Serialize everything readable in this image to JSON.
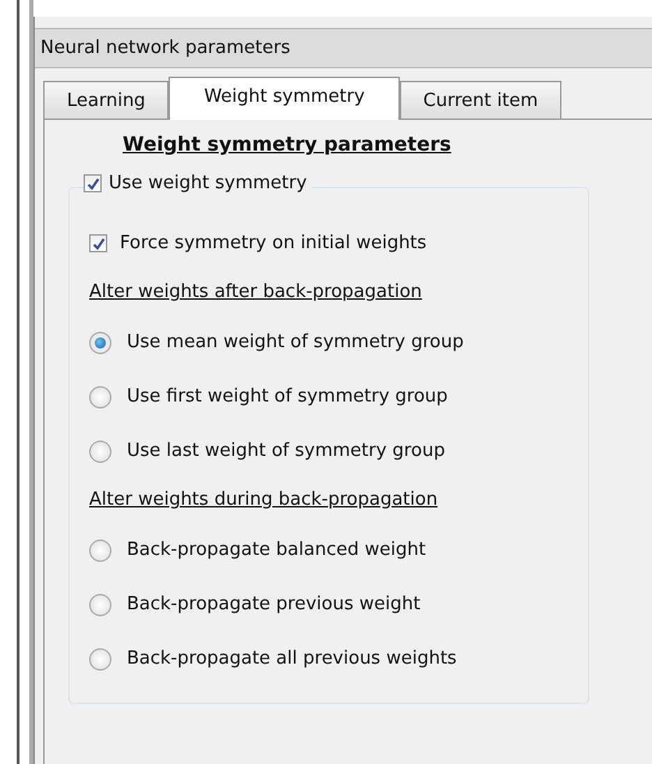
{
  "panel": {
    "title": "Neural network parameters"
  },
  "tabs": [
    {
      "label": "Learning",
      "selected": false
    },
    {
      "label": "Weight symmetry",
      "selected": true
    },
    {
      "label": "Current item",
      "selected": false
    }
  ],
  "section_title": "Weight symmetry parameters",
  "group": {
    "label": "Use weight symmetry",
    "checked": true,
    "items": [
      {
        "kind": "checkbox",
        "label": "Force symmetry on initial weights",
        "checked": true
      },
      {
        "kind": "heading",
        "label": "Alter weights after back-propagation"
      },
      {
        "kind": "radio",
        "label": "Use mean weight of symmetry group",
        "selected": true
      },
      {
        "kind": "radio",
        "label": "Use first weight of symmetry group",
        "selected": false
      },
      {
        "kind": "radio",
        "label": "Use last weight of symmetry group",
        "selected": false
      },
      {
        "kind": "heading",
        "label": "Alter weights during back-propagation"
      },
      {
        "kind": "radio",
        "label": "Back-propagate balanced weight",
        "selected": false
      },
      {
        "kind": "radio",
        "label": "Back-propagate previous weight",
        "selected": false
      },
      {
        "kind": "radio",
        "label": "Back-propagate all previous weights",
        "selected": false
      }
    ]
  }
}
